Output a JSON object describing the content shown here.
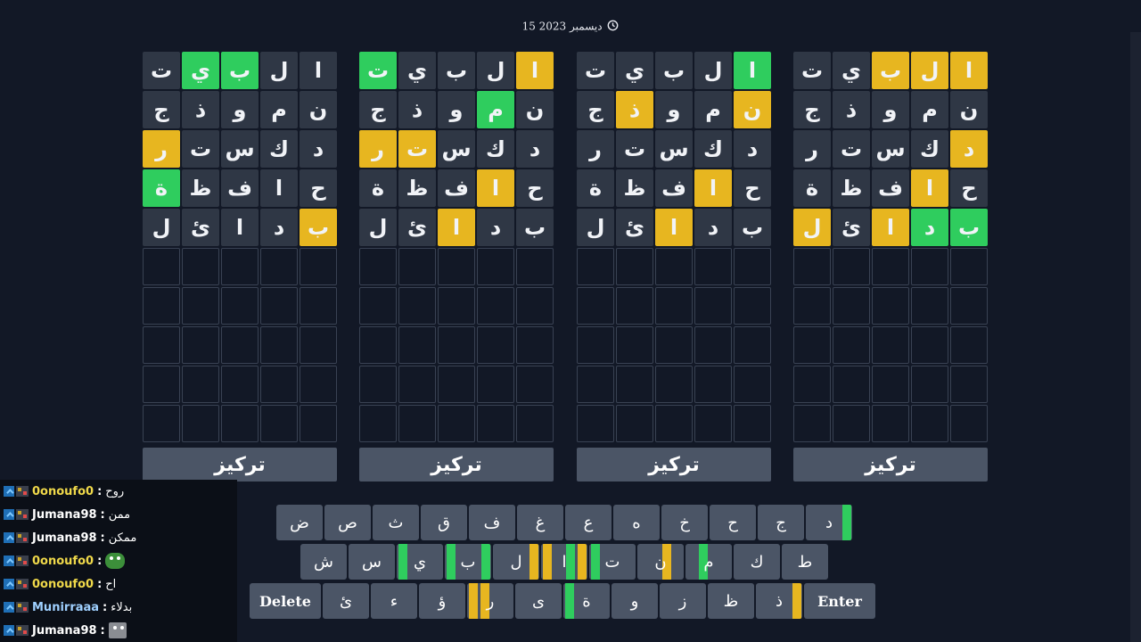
{
  "date_text": "15 ديسمبر 2023",
  "focus_label": "تركيز",
  "colors": {
    "green": "#2fcd5e",
    "yellow": "#e7b620",
    "tile": "#2f3745",
    "empty_border": "#394253",
    "key": "#4b5566",
    "background": "#121826"
  },
  "boards": [
    {
      "rows": [
        [
          {
            "l": "ا",
            "s": "n"
          },
          {
            "l": "ل",
            "s": "n"
          },
          {
            "l": "ب",
            "s": "g"
          },
          {
            "l": "ي",
            "s": "g"
          },
          {
            "l": "ت",
            "s": "n"
          }
        ],
        [
          {
            "l": "ن",
            "s": "n"
          },
          {
            "l": "م",
            "s": "n"
          },
          {
            "l": "و",
            "s": "n"
          },
          {
            "l": "ذ",
            "s": "n"
          },
          {
            "l": "ج",
            "s": "n"
          }
        ],
        [
          {
            "l": "د",
            "s": "n"
          },
          {
            "l": "ك",
            "s": "n"
          },
          {
            "l": "س",
            "s": "n"
          },
          {
            "l": "ت",
            "s": "n"
          },
          {
            "l": "ر",
            "s": "y"
          }
        ],
        [
          {
            "l": "ح",
            "s": "n"
          },
          {
            "l": "ا",
            "s": "n"
          },
          {
            "l": "ف",
            "s": "n"
          },
          {
            "l": "ظ",
            "s": "n"
          },
          {
            "l": "ة",
            "s": "g"
          }
        ],
        [
          {
            "l": "ب",
            "s": "y"
          },
          {
            "l": "د",
            "s": "n"
          },
          {
            "l": "ا",
            "s": "n"
          },
          {
            "l": "ئ",
            "s": "n"
          },
          {
            "l": "ل",
            "s": "n"
          }
        ]
      ]
    },
    {
      "rows": [
        [
          {
            "l": "ا",
            "s": "y"
          },
          {
            "l": "ل",
            "s": "n"
          },
          {
            "l": "ب",
            "s": "n"
          },
          {
            "l": "ي",
            "s": "n"
          },
          {
            "l": "ت",
            "s": "g"
          }
        ],
        [
          {
            "l": "ن",
            "s": "n"
          },
          {
            "l": "م",
            "s": "g"
          },
          {
            "l": "و",
            "s": "n"
          },
          {
            "l": "ذ",
            "s": "n"
          },
          {
            "l": "ج",
            "s": "n"
          }
        ],
        [
          {
            "l": "د",
            "s": "n"
          },
          {
            "l": "ك",
            "s": "n"
          },
          {
            "l": "س",
            "s": "n"
          },
          {
            "l": "ت",
            "s": "y"
          },
          {
            "l": "ر",
            "s": "y"
          }
        ],
        [
          {
            "l": "ح",
            "s": "n"
          },
          {
            "l": "ا",
            "s": "y"
          },
          {
            "l": "ف",
            "s": "n"
          },
          {
            "l": "ظ",
            "s": "n"
          },
          {
            "l": "ة",
            "s": "n"
          }
        ],
        [
          {
            "l": "ب",
            "s": "n"
          },
          {
            "l": "د",
            "s": "n"
          },
          {
            "l": "ا",
            "s": "y"
          },
          {
            "l": "ئ",
            "s": "n"
          },
          {
            "l": "ل",
            "s": "n"
          }
        ]
      ]
    },
    {
      "rows": [
        [
          {
            "l": "ا",
            "s": "g"
          },
          {
            "l": "ل",
            "s": "n"
          },
          {
            "l": "ب",
            "s": "n"
          },
          {
            "l": "ي",
            "s": "n"
          },
          {
            "l": "ت",
            "s": "n"
          }
        ],
        [
          {
            "l": "ن",
            "s": "y"
          },
          {
            "l": "م",
            "s": "n"
          },
          {
            "l": "و",
            "s": "n"
          },
          {
            "l": "ذ",
            "s": "y"
          },
          {
            "l": "ج",
            "s": "n"
          }
        ],
        [
          {
            "l": "د",
            "s": "n"
          },
          {
            "l": "ك",
            "s": "n"
          },
          {
            "l": "س",
            "s": "n"
          },
          {
            "l": "ت",
            "s": "n"
          },
          {
            "l": "ر",
            "s": "n"
          }
        ],
        [
          {
            "l": "ح",
            "s": "n"
          },
          {
            "l": "ا",
            "s": "y"
          },
          {
            "l": "ف",
            "s": "n"
          },
          {
            "l": "ظ",
            "s": "n"
          },
          {
            "l": "ة",
            "s": "n"
          }
        ],
        [
          {
            "l": "ب",
            "s": "n"
          },
          {
            "l": "د",
            "s": "n"
          },
          {
            "l": "ا",
            "s": "y"
          },
          {
            "l": "ئ",
            "s": "n"
          },
          {
            "l": "ل",
            "s": "n"
          }
        ]
      ]
    },
    {
      "rows": [
        [
          {
            "l": "ا",
            "s": "y"
          },
          {
            "l": "ل",
            "s": "y"
          },
          {
            "l": "ب",
            "s": "y"
          },
          {
            "l": "ي",
            "s": "n"
          },
          {
            "l": "ت",
            "s": "n"
          }
        ],
        [
          {
            "l": "ن",
            "s": "n"
          },
          {
            "l": "م",
            "s": "n"
          },
          {
            "l": "و",
            "s": "n"
          },
          {
            "l": "ذ",
            "s": "n"
          },
          {
            "l": "ج",
            "s": "n"
          }
        ],
        [
          {
            "l": "د",
            "s": "y"
          },
          {
            "l": "ك",
            "s": "n"
          },
          {
            "l": "س",
            "s": "n"
          },
          {
            "l": "ت",
            "s": "n"
          },
          {
            "l": "ر",
            "s": "n"
          }
        ],
        [
          {
            "l": "ح",
            "s": "n"
          },
          {
            "l": "ا",
            "s": "y"
          },
          {
            "l": "ف",
            "s": "n"
          },
          {
            "l": "ظ",
            "s": "n"
          },
          {
            "l": "ة",
            "s": "n"
          }
        ],
        [
          {
            "l": "ب",
            "s": "g"
          },
          {
            "l": "د",
            "s": "g"
          },
          {
            "l": "ا",
            "s": "y"
          },
          {
            "l": "ئ",
            "s": "n"
          },
          {
            "l": "ل",
            "s": "y"
          }
        ]
      ]
    }
  ],
  "keyboard": {
    "rows": [
      [
        {
          "k": "ض",
          "m": ""
        },
        {
          "k": "ص",
          "m": ""
        },
        {
          "k": "ث",
          "m": ""
        },
        {
          "k": "ق",
          "m": ""
        },
        {
          "k": "ف",
          "m": ""
        },
        {
          "k": "غ",
          "m": ""
        },
        {
          "k": "ع",
          "m": ""
        },
        {
          "k": "ه",
          "m": ""
        },
        {
          "k": "خ",
          "m": ""
        },
        {
          "k": "ح",
          "m": ""
        },
        {
          "k": "ج",
          "m": ""
        },
        {
          "k": "د",
          "m": "...g"
        }
      ],
      [
        {
          "k": "ش",
          "m": ""
        },
        {
          "k": "س",
          "m": ""
        },
        {
          "k": "ي",
          "m": "g..."
        },
        {
          "k": "ب",
          "m": "g..g"
        },
        {
          "k": "ل",
          "m": "...y"
        },
        {
          "k": "ا",
          "m": "y.gy"
        },
        {
          "k": "ت",
          "m": "g..."
        },
        {
          "k": "ن",
          "m": "..y."
        },
        {
          "k": "م",
          "m": ".g.."
        },
        {
          "k": "ك",
          "m": ""
        },
        {
          "k": "ط",
          "m": ""
        }
      ],
      [
        {
          "k": "Delete",
          "m": "",
          "wide": true
        },
        {
          "k": "ئ",
          "m": ""
        },
        {
          "k": "ء",
          "m": ""
        },
        {
          "k": "ؤ",
          "m": ""
        },
        {
          "k": "ر",
          "m": "yy.."
        },
        {
          "k": "ى",
          "m": ""
        },
        {
          "k": "ة",
          "m": "g..."
        },
        {
          "k": "و",
          "m": ""
        },
        {
          "k": "ز",
          "m": ""
        },
        {
          "k": "ظ",
          "m": ""
        },
        {
          "k": "ذ",
          "m": "...y"
        },
        {
          "k": "Enter",
          "m": "",
          "wide": true
        }
      ]
    ]
  },
  "chat": [
    {
      "user": "0onoufo0",
      "msg": "روح",
      "emote": ""
    },
    {
      "user": "Jumana98",
      "msg": "ممن",
      "emote": ""
    },
    {
      "user": "Jumana98",
      "msg": "ممكن",
      "emote": ""
    },
    {
      "user": "0onoufo0",
      "msg": "",
      "emote": "frog-emote"
    },
    {
      "user": "0onoufo0",
      "msg": "اح",
      "emote": ""
    },
    {
      "user": "Munirraaa",
      "msg": "بدلاء",
      "emote": ""
    },
    {
      "user": "Jumana98",
      "msg": "",
      "emote": "cat-emote"
    }
  ]
}
